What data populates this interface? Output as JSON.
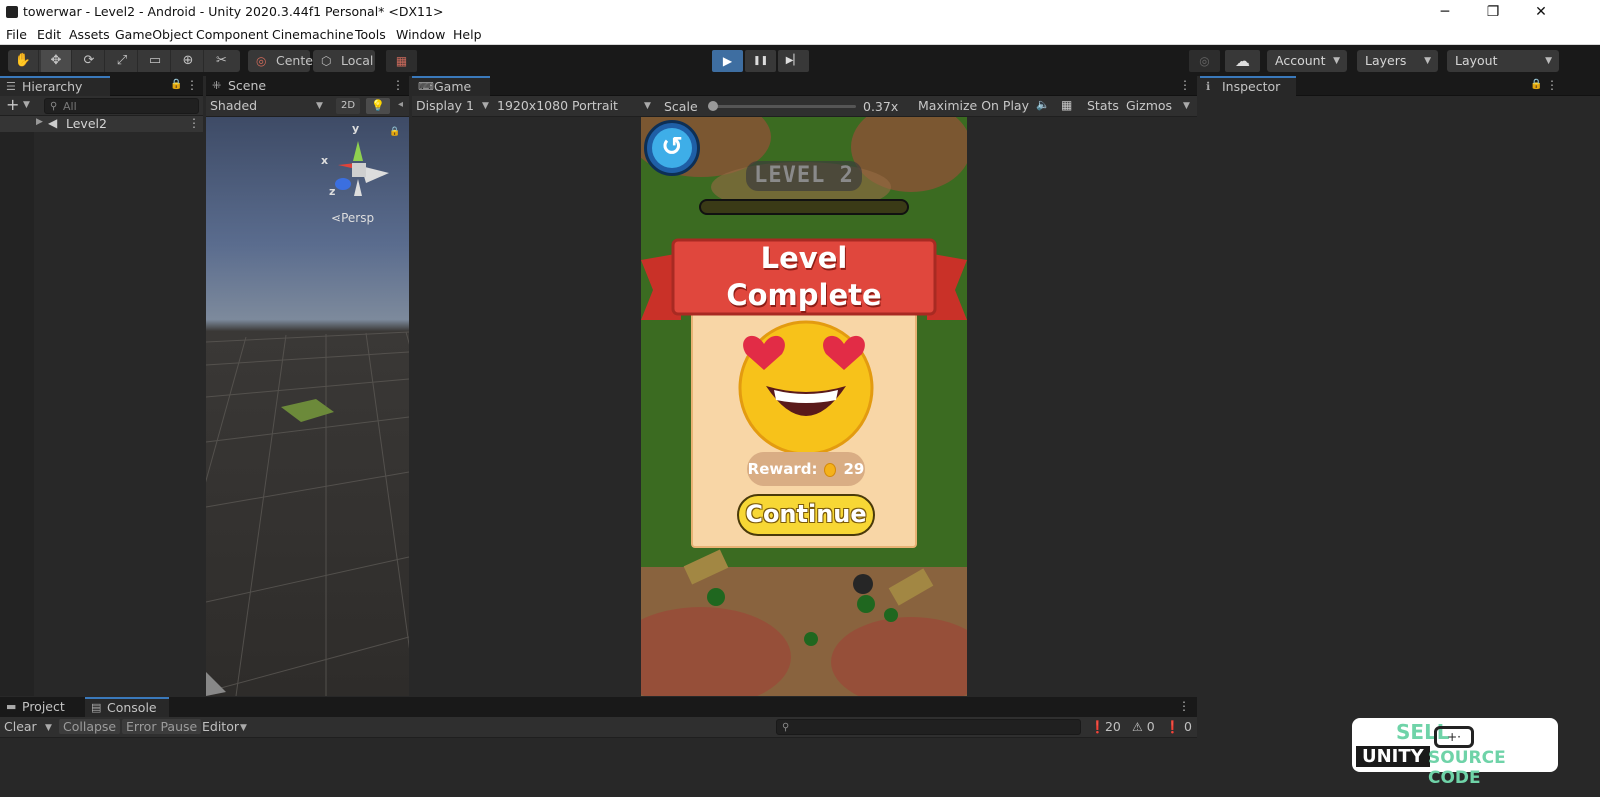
{
  "window": {
    "title": "towerwar - Level2 - Android - Unity 2020.3.44f1 Personal* <DX11>",
    "controls": {
      "minimize": "─",
      "restore": "❐",
      "close": "✕"
    }
  },
  "menu": [
    "File",
    "Edit",
    "Assets",
    "GameObject",
    "Component",
    "Cinemachine",
    "Tools",
    "Window",
    "Help"
  ],
  "toolbar": {
    "tools": [
      "✋",
      "✥",
      "⟳",
      "⤢",
      "▭",
      "⊕",
      "✂"
    ],
    "pivot_mode": "Center",
    "pivot_rotation": "Local",
    "grid_snap_icon": "▦",
    "play_icon": "▶",
    "pause_icon": "❚❚",
    "step_icon": "▶▏",
    "collab_icon": "◎",
    "cloud_icon": "☁",
    "account": "Account",
    "layers": "Layers",
    "layout": "Layout"
  },
  "hierarchy": {
    "tab": "Hierarchy",
    "add_icon": "+",
    "search_placeholder": "All",
    "scene_item": "Level2"
  },
  "scene": {
    "tab": "Scene",
    "shading": "Shaded",
    "mode_2d": "2D",
    "gizmo_axes": {
      "x": "x",
      "y": "y",
      "z": "z"
    },
    "projection": "Persp"
  },
  "game": {
    "tab": "Game",
    "display": "Display 1",
    "resolution": "1920x1080 Portrait",
    "scale_label": "Scale",
    "scale_value": "0.37x",
    "scale_fraction": 0.0,
    "maximize": "Maximize On Play",
    "stats": "Stats",
    "gizmos": "Gizmos",
    "level_title": "LEVEL 2",
    "popup": {
      "title_line1": "Level",
      "title_line2": "Complete",
      "reward_label": "Reward:",
      "reward_value": "29",
      "continue": "Continue"
    }
  },
  "inspector": {
    "tab": "Inspector"
  },
  "console": {
    "tab_project": "Project",
    "tab_console": "Console",
    "clear": "Clear",
    "collapse": "Collapse",
    "error_pause": "Error Pause",
    "editor": "Editor",
    "count_log": "20",
    "count_warn": "0",
    "count_error": "0"
  },
  "watermark": {
    "line1": "SELL",
    "line2a": "UNITY",
    "line2b": "SOURCE CODE"
  },
  "colors": {
    "accent": "#3a79bb",
    "play_active": "#3e6ea1",
    "ribbon_red": "#e0473d",
    "continue_yellow": "#f7d735"
  }
}
